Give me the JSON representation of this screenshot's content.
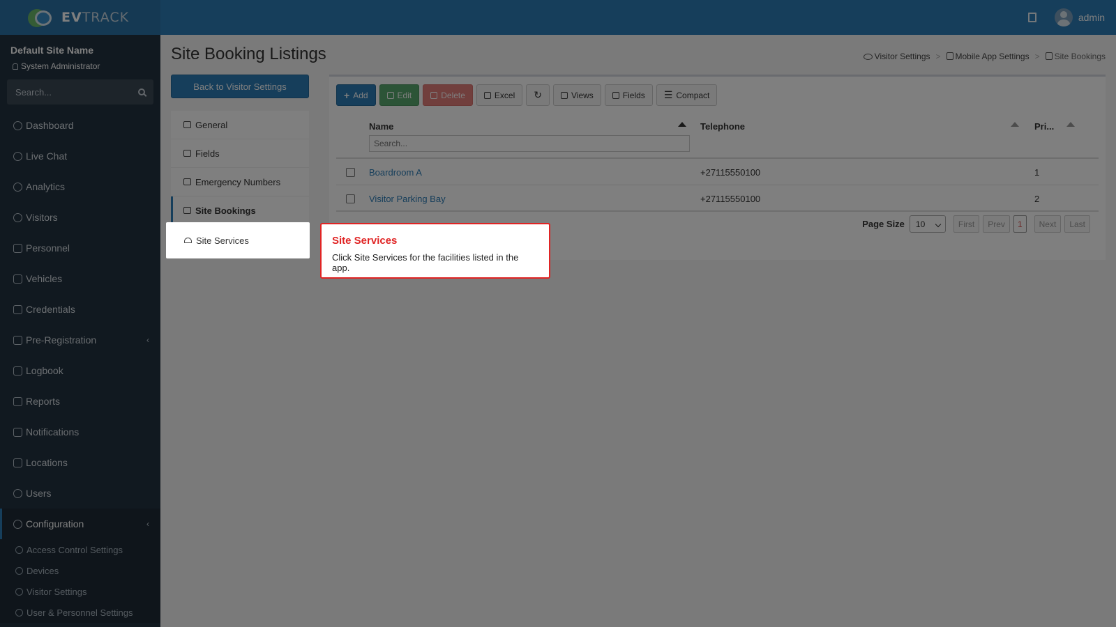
{
  "header": {
    "logo_strong": "EV",
    "logo_rest": "TRACK",
    "user": "admin"
  },
  "sidebar": {
    "site_name": "Default Site Name",
    "role": "System Administrator",
    "search_placeholder": "Search...",
    "items": [
      {
        "label": "Dashboard",
        "icon": "dashboard-icon"
      },
      {
        "label": "Live Chat",
        "icon": "headset-icon"
      },
      {
        "label": "Analytics",
        "icon": "analytics-icon"
      },
      {
        "label": "Visitors",
        "icon": "eye-icon"
      },
      {
        "label": "Personnel",
        "icon": "personnel-icon"
      },
      {
        "label": "Vehicles",
        "icon": "car-icon"
      },
      {
        "label": "Credentials",
        "icon": "id-card-icon"
      },
      {
        "label": "Pre-Registration",
        "icon": "arrows-icon"
      },
      {
        "label": "Logbook",
        "icon": "book-icon"
      },
      {
        "label": "Reports",
        "icon": "reports-icon"
      },
      {
        "label": "Notifications",
        "icon": "notification-icon"
      },
      {
        "label": "Locations",
        "icon": "map-icon"
      },
      {
        "label": "Users",
        "icon": "users-icon"
      },
      {
        "label": "Configuration",
        "icon": "gear-icon"
      }
    ],
    "sub_items": [
      {
        "label": "Access Control Settings",
        "icon": "lock-icon"
      },
      {
        "label": "Devices",
        "icon": "device-icon"
      },
      {
        "label": "Visitor Settings",
        "icon": "eye-icon"
      },
      {
        "label": "User & Personnel Settings",
        "icon": "users-icon"
      }
    ]
  },
  "page": {
    "title": "Site Booking Listings",
    "back_button": "Back to Visitor Settings",
    "breadcrumb": [
      "Visitor Settings",
      "Mobile App Settings",
      "Site Bookings"
    ]
  },
  "subnav": [
    {
      "label": "General",
      "icon": "sliders-icon"
    },
    {
      "label": "Fields",
      "icon": "list-check-icon"
    },
    {
      "label": "Emergency Numbers",
      "icon": "phone-icon"
    },
    {
      "label": "Site Bookings",
      "icon": "calendar-icon"
    },
    {
      "label": "Site Services",
      "icon": "bell-service-icon"
    }
  ],
  "toolbar": {
    "add": "Add",
    "edit": "Edit",
    "delete": "Delete",
    "excel": "Excel",
    "views": "Views",
    "fields": "Fields",
    "compact": "Compact"
  },
  "grid": {
    "columns": [
      "Name",
      "Telephone",
      "Pri..."
    ],
    "search_placeholder": "Search...",
    "rows": [
      {
        "name": "Boardroom A",
        "telephone": "+27115550100",
        "priority": "1"
      },
      {
        "name": "Visitor Parking Bay",
        "telephone": "+27115550100",
        "priority": "2"
      }
    ]
  },
  "pager": {
    "label": "Page Size",
    "size": "10",
    "first": "First",
    "prev": "Prev",
    "current": "1",
    "next": "Next",
    "last": "Last"
  },
  "tour": {
    "title": "Site Services",
    "body": "Click Site Services for the facilities listed in the app."
  },
  "colors": {
    "primary": "#2d7db6",
    "sidebar": "#233240",
    "tour_accent": "#e02424"
  }
}
